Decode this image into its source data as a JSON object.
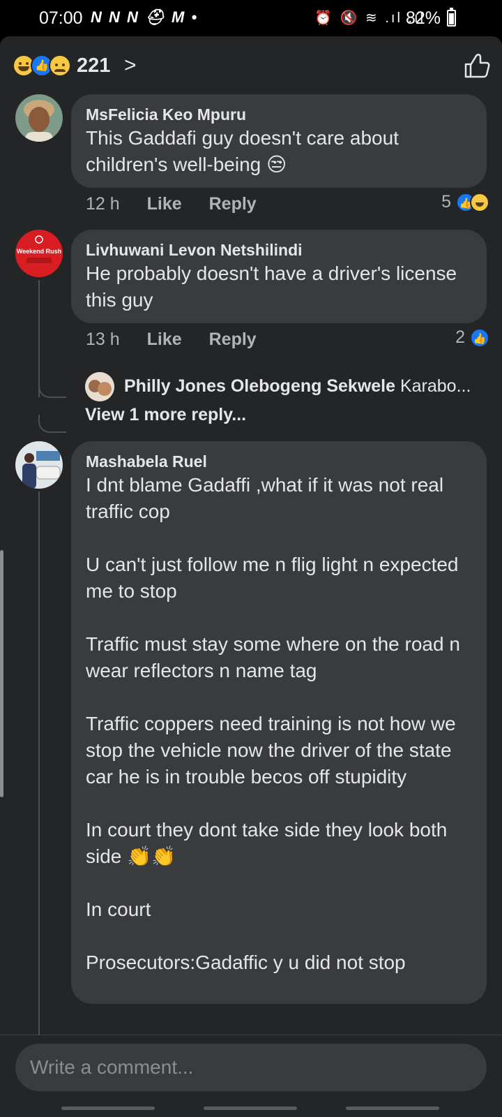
{
  "status_bar": {
    "time": "07:00",
    "left_icons": "N N N ⛑ M •",
    "right_icons": "⏰ 🔇 ≋ .ıl .ıl",
    "battery": "82%"
  },
  "reactions_header": {
    "total": "221",
    "emojis": [
      "haha-icon",
      "like-icon",
      "sad-icon"
    ]
  },
  "comments": [
    {
      "author": "MsFelicia Keo Mpuru",
      "text": "This Gaddafi guy doesn't care about children's well-being 😒",
      "time": "12 h",
      "like": "Like",
      "reply": "Reply",
      "reaction_count": "5"
    },
    {
      "author": "Livhuwani Levon Netshilindi",
      "text": "He probably doesn't have a driver's license this guy",
      "time": "13 h",
      "like": "Like",
      "reply": "Reply",
      "reaction_count": "2",
      "avatar_text": "Weekend Rush"
    },
    {
      "author": "Mashabela Ruel",
      "text": "I dnt blame Gadaffi ,what if it was not real traffic cop\n\nU can't just follow me n flig light n expected me to stop\n\nTraffic must stay some where on the road n wear reflectors n name tag\n\nTraffic coppers need training is not how we stop the vehicle now the driver of the state car he is in trouble becos off stupidity\n\nIn court they dont take side they look both side 👏👏\n\nIn court\n\nProsecutors:Gadaffic y u did not stop"
    }
  ],
  "reply_preview": {
    "author": "Philly Jones Olebogeng Sekwele",
    "snippet": "Karabo..."
  },
  "view_more": "View 1 more reply...",
  "composer": {
    "placeholder": "Write a comment..."
  }
}
